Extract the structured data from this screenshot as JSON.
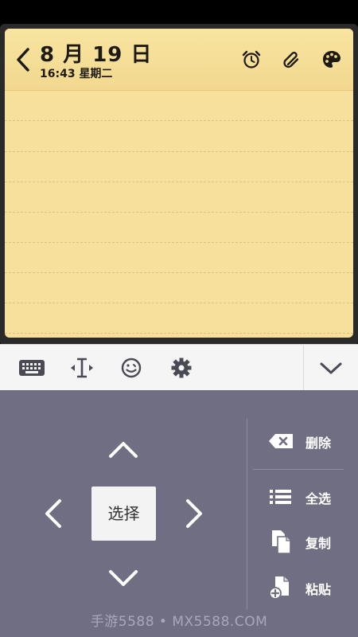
{
  "note": {
    "date": "8 月 19 日",
    "time": "16:43 星期二",
    "icons": [
      "back-chevron-icon",
      "alarm-clock-icon",
      "paperclip-icon",
      "palette-icon"
    ],
    "background_color": "#f7e09c"
  },
  "toolbar": {
    "icons": [
      "keyboard-icon",
      "text-cursor-icon",
      "emoji-icon",
      "gear-icon",
      "chevron-down-icon"
    ]
  },
  "cursor_pad": {
    "select_label": "选择",
    "arrows": [
      "up",
      "left",
      "right",
      "down"
    ]
  },
  "actions": [
    {
      "label": "删除",
      "icon": "backspace-icon"
    },
    {
      "label": "全选",
      "icon": "select-all-list-icon"
    },
    {
      "label": "复制",
      "icon": "copy-icon"
    },
    {
      "label": "粘贴",
      "icon": "paste-icon"
    }
  ],
  "watermark": "手游5588 • MX5588.COM",
  "colors": {
    "panel": "#6f6e82",
    "toolbar": "#f5f5f5",
    "note": "#f7e09c"
  }
}
